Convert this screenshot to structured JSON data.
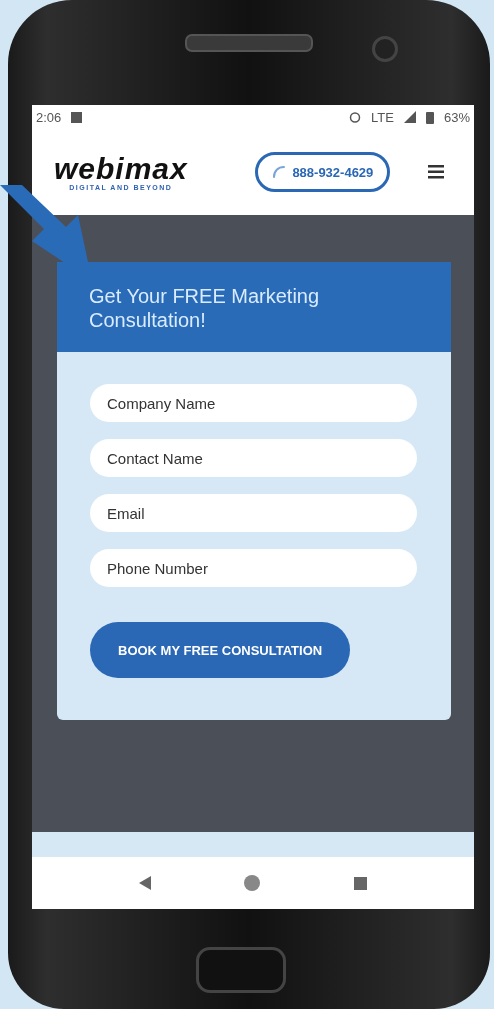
{
  "status_bar": {
    "time": "2:06",
    "network": "LTE",
    "battery": "63%"
  },
  "header": {
    "logo": "webimax",
    "tagline": "DIGITAL AND BEYOND",
    "phone": "888-932-4629"
  },
  "form": {
    "title": "Get Your FREE Marketing Consultation!",
    "fields": [
      {
        "placeholder": "Company Name"
      },
      {
        "placeholder": "Contact Name"
      },
      {
        "placeholder": "Email"
      },
      {
        "placeholder": "Phone Number"
      }
    ],
    "submit": "BOOK MY FREE CONSULTATION"
  }
}
